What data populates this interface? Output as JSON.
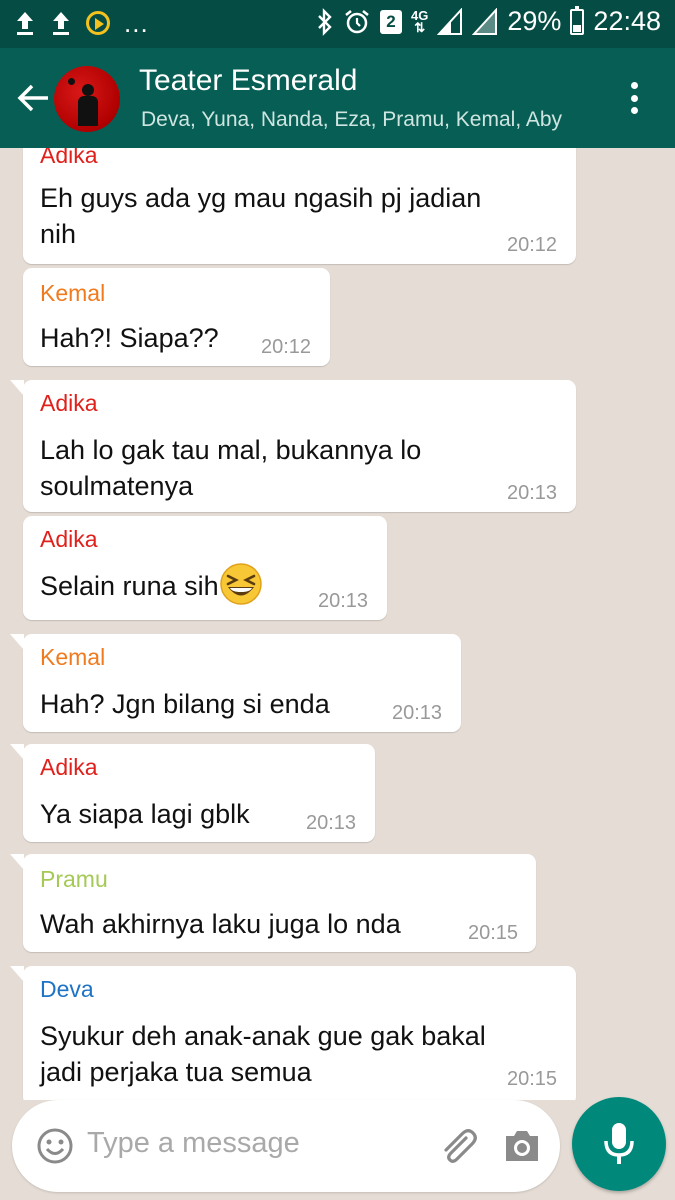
{
  "status_bar": {
    "notification_overflow": "...",
    "sim_slot": "2",
    "network_type": "4G",
    "battery_percent": "29%",
    "clock": "22:48",
    "icons": [
      "upload-icon",
      "upload-icon",
      "app-notification-icon",
      "bluetooth-icon",
      "alarm-icon",
      "signal-icon",
      "battery-icon"
    ]
  },
  "header": {
    "title": "Teater Esmerald",
    "participants": "Deva, Yuna, Nanda, Eza, Pramu, Kemal, Aby",
    "back_icon": "arrow-back-icon",
    "menu_icon": "more-vert-icon"
  },
  "colors": {
    "header_bg": "#075e54",
    "status_bg": "#054d44",
    "chat_bg": "#e5ddd5",
    "sender_adika": "#e0201b",
    "sender_kemal": "#f07b1f",
    "sender_pramu": "#a5c956",
    "sender_deva": "#1e73c5",
    "fab": "#00897b"
  },
  "messages": [
    {
      "sender": "Adika",
      "line1": "Eh guys ada yg mau ngasih pj jadian",
      "line2": "nih",
      "time": "20:12"
    },
    {
      "sender": "Kemal",
      "line1": "Hah?! Siapa??",
      "time": "20:12"
    },
    {
      "sender": "Adika",
      "line1": "Lah lo gak tau mal, bukannya lo",
      "line2": "soulmatenya",
      "time": "20:13"
    },
    {
      "sender": "Adika",
      "line1": "Selain runa sih",
      "emoji": "grinning-squinting-face-emoji",
      "time": "20:13"
    },
    {
      "sender": "Kemal",
      "line1": "Hah? Jgn bilang si enda",
      "time": "20:13"
    },
    {
      "sender": "Adika",
      "line1": "Ya siapa lagi gblk",
      "time": "20:13"
    },
    {
      "sender": "Pramu",
      "line1": "Wah akhirnya laku juga lo nda",
      "time": "20:15"
    },
    {
      "sender": "Deva",
      "line1": "Syukur deh anak-anak gue gak bakal",
      "line2": "jadi perjaka tua semua",
      "time": "20:15"
    }
  ],
  "composer": {
    "placeholder": "Type a message",
    "emoji_icon": "smiley-icon",
    "attach_icon": "paperclip-icon",
    "camera_icon": "camera-icon",
    "mic_icon": "microphone-icon"
  }
}
